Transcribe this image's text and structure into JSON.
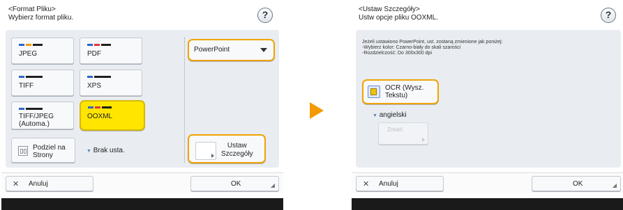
{
  "left": {
    "header_line1": "<Format Pliku>",
    "header_line2": "Wybierz format pliku.",
    "help": "?",
    "formats": [
      {
        "label": "JPEG",
        "bar_colors": [
          "#2f66c7",
          "#f39a00",
          "#1f1f1f"
        ]
      },
      {
        "label": "PDF",
        "bar_colors": [
          "#2f66c7",
          "#e0353a",
          "#1f1f1f"
        ]
      },
      {
        "label": "TIFF",
        "bar_colors": [
          "#2f66c7",
          "#1f1f1f",
          "#1f1f1f"
        ]
      },
      {
        "label": "XPS",
        "bar_colors": [
          "#2f66c7",
          "#1f1f1f",
          "#1f1f1f"
        ]
      },
      {
        "label_line1": "TIFF/JPEG",
        "label_line2": "(Automa.)",
        "bar_colors": [
          "#2f66c7",
          "#1f1f1f",
          "#1f1f1f"
        ]
      },
      {
        "label": "OOXML",
        "bar_colors": [
          "#2f66c7",
          "#e0353a",
          "#1f1f1f"
        ],
        "selected": true
      }
    ],
    "split_pages_line1": "Podziel na",
    "split_pages_line2": "Strony",
    "split_pages_value": "Brak usta.",
    "dropdown_value": "PowerPoint",
    "details_line1": "Ustaw",
    "details_line2": "Szczegóły",
    "cancel": "Anuluj",
    "ok": "OK"
  },
  "right": {
    "header_line1": "<Ustaw Szczegóły>",
    "header_line2": "Ustw opcje pliku OOXML.",
    "help": "?",
    "info_line1": "Jeżeli ustawiono PowerPoint, ust. zostaną zmienione jak poniżej:",
    "info_line2": "-Wybierz kolor: Czarno-biały do skali szarości",
    "info_line3": "-Rozdzielczość: Do 300x300 dpi",
    "ocr_line1": "OCR (Wysz.",
    "ocr_line2": "Tekstu)",
    "language": "angielski",
    "change": "Zmień",
    "cancel": "Anuluj",
    "ok": "OK"
  },
  "colors": {
    "accent": "#f0a300",
    "selected": "#ffe500",
    "arrow": "#f39a00"
  }
}
